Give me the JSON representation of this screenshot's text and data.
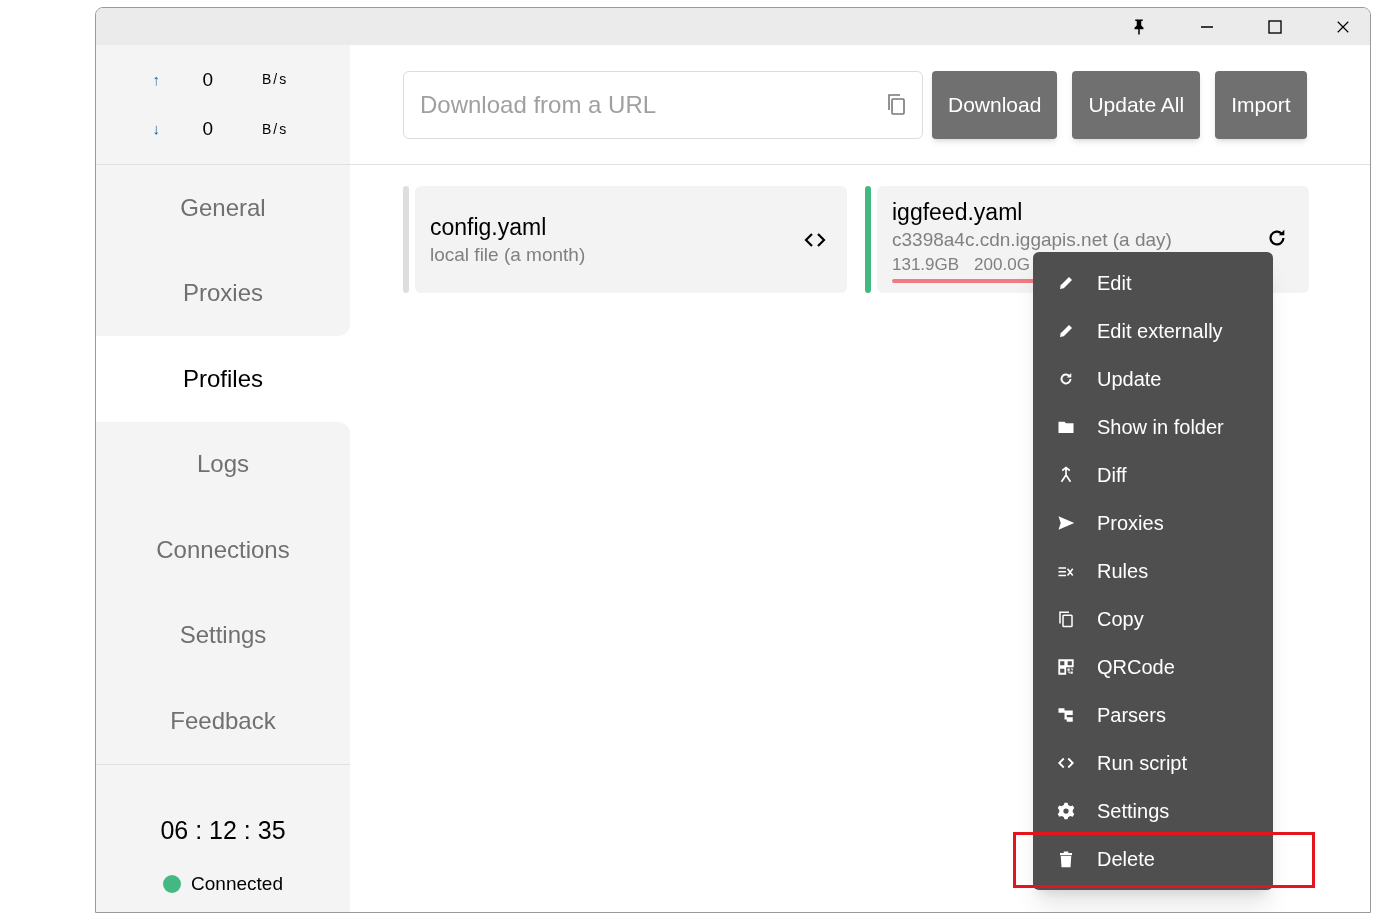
{
  "window": {
    "controls": [
      {
        "kind": "pin"
      },
      {
        "kind": "minimize"
      },
      {
        "kind": "maximize"
      },
      {
        "kind": "close"
      }
    ]
  },
  "traffic": [
    {
      "kind": "up",
      "arrow": "↑",
      "value": "0",
      "unit": "B/s"
    },
    {
      "kind": "down",
      "arrow": "↓",
      "value": "0",
      "unit": "B/s"
    }
  ],
  "nav": [
    {
      "label": "General",
      "selected": false
    },
    {
      "label": "Proxies",
      "selected": false
    },
    {
      "label": "Profiles",
      "selected": true
    },
    {
      "label": "Logs",
      "selected": false
    },
    {
      "label": "Connections",
      "selected": false
    },
    {
      "label": "Settings",
      "selected": false
    },
    {
      "label": "Feedback",
      "selected": false
    }
  ],
  "uptime": "06 : 12 : 35",
  "connection": {
    "label": "Connected",
    "color": "#43b883"
  },
  "url_field": {
    "placeholder": "Download from a URL"
  },
  "buttons": [
    "Download",
    "Update All",
    "Import"
  ],
  "profiles": [
    {
      "kind": "local",
      "name": "config.yaml",
      "detail": "local file (a month)",
      "selected": false
    },
    {
      "kind": "remote",
      "name": "iggfeed.yaml",
      "detail": "c3398a4c.cdn.iggapis.net (a day)",
      "used": "131.9GB",
      "total": "200.0G",
      "selected": true
    }
  ],
  "context_menu": [
    {
      "kind": "edit",
      "label": "Edit",
      "highlighted": false
    },
    {
      "kind": "edit",
      "label": "Edit externally",
      "highlighted": false
    },
    {
      "kind": "update",
      "label": "Update",
      "highlighted": false
    },
    {
      "kind": "folder",
      "label": "Show in folder",
      "highlighted": false
    },
    {
      "kind": "diff",
      "label": "Diff",
      "highlighted": false
    },
    {
      "kind": "proxies",
      "label": "Proxies",
      "highlighted": false
    },
    {
      "kind": "rules",
      "label": "Rules",
      "highlighted": false
    },
    {
      "kind": "copy",
      "label": "Copy",
      "highlighted": false
    },
    {
      "kind": "qrcode",
      "label": "QRCode",
      "highlighted": false
    },
    {
      "kind": "parsers",
      "label": "Parsers",
      "highlighted": false
    },
    {
      "kind": "script",
      "label": "Run script",
      "highlighted": false
    },
    {
      "kind": "settings",
      "label": "Settings",
      "highlighted": false
    },
    {
      "kind": "delete",
      "label": "Delete",
      "highlighted": true
    }
  ]
}
